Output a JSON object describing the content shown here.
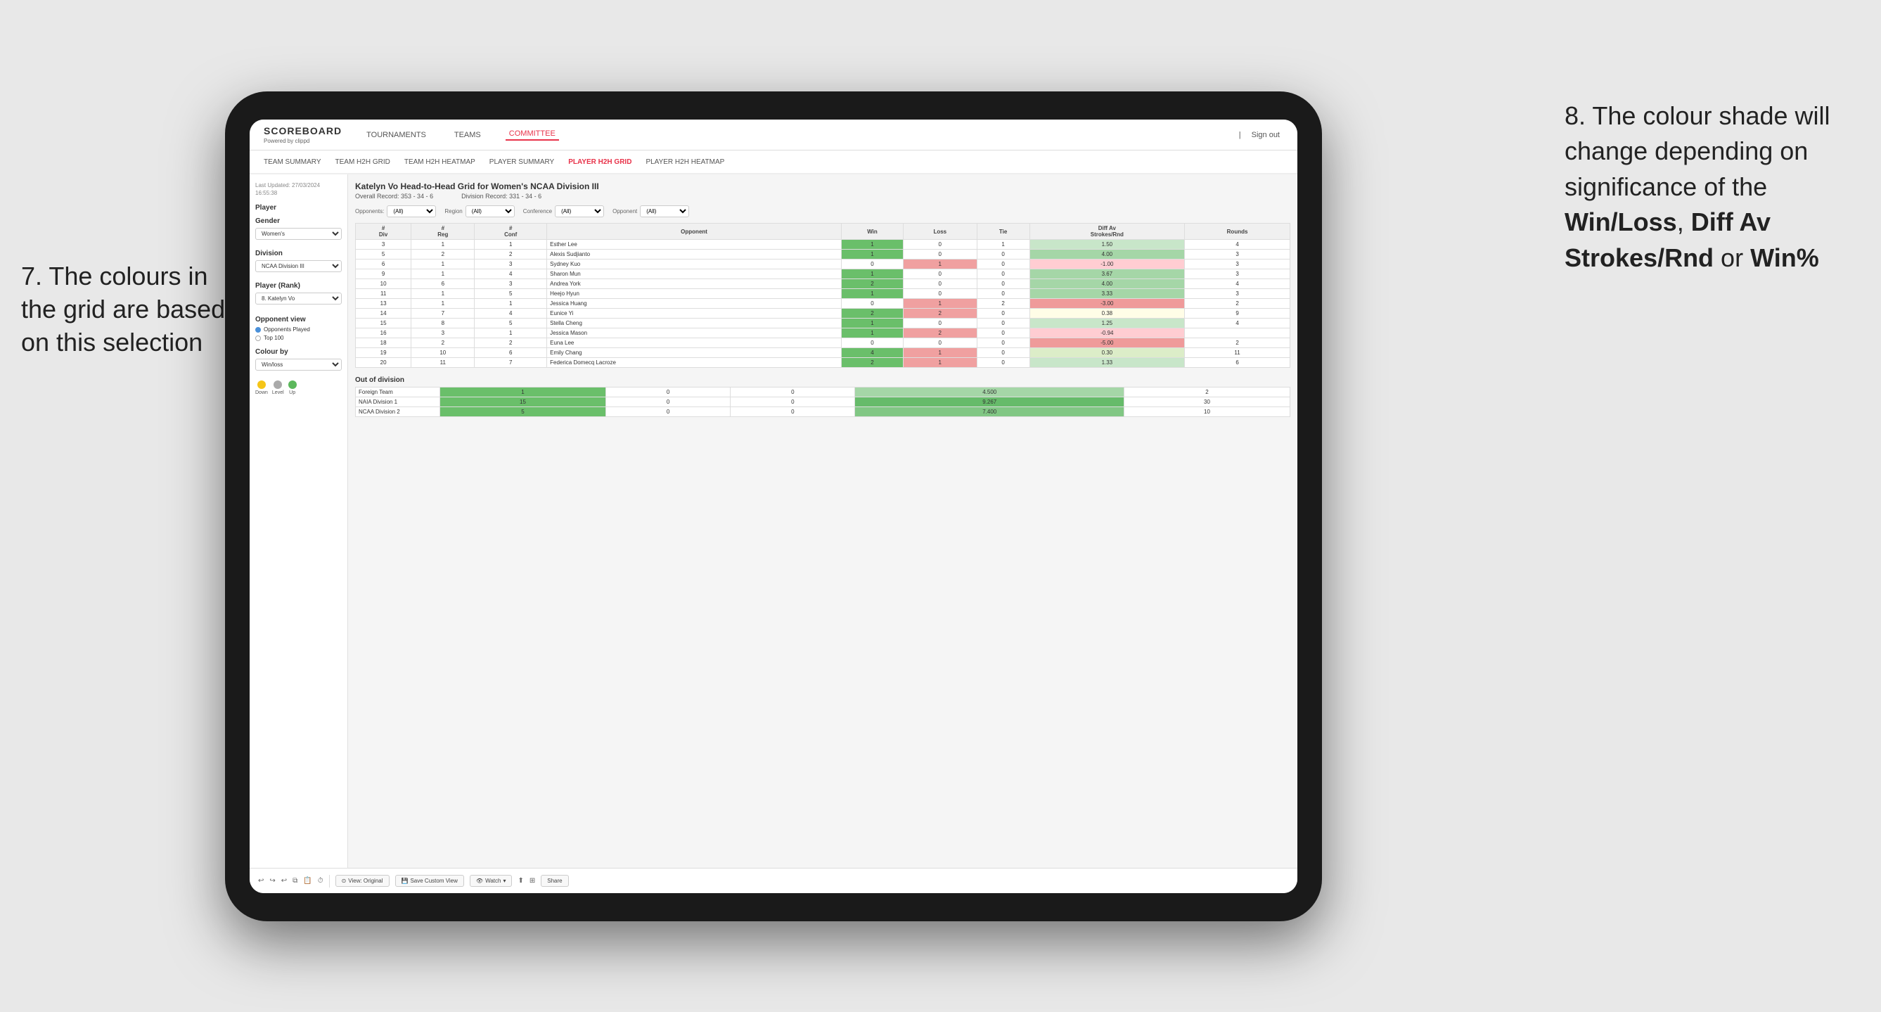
{
  "annotations": {
    "left_text_line1": "7. The colours in",
    "left_text_line2": "the grid are based",
    "left_text_line3": "on this selection",
    "right_text_intro": "8. The colour shade will change depending on significance of the ",
    "right_bold1": "Win/Loss",
    "right_comma": ", ",
    "right_bold2": "Diff Av Strokes/Rnd",
    "right_or": " or ",
    "right_bold3": "Win%"
  },
  "nav": {
    "logo": "SCOREBOARD",
    "logo_sub": "Powered by clippd",
    "items": [
      "TOURNAMENTS",
      "TEAMS",
      "COMMITTEE"
    ],
    "active": "COMMITTEE",
    "sign_in": "Sign out"
  },
  "sub_nav": {
    "items": [
      "TEAM SUMMARY",
      "TEAM H2H GRID",
      "TEAM H2H HEATMAP",
      "PLAYER SUMMARY",
      "PLAYER H2H GRID",
      "PLAYER H2H HEATMAP"
    ],
    "active": "PLAYER H2H GRID"
  },
  "left_panel": {
    "last_updated_label": "Last Updated: 27/03/2024",
    "last_updated_time": "16:55:38",
    "player_label": "Player",
    "gender_label": "Gender",
    "gender_value": "Women's",
    "division_label": "Division",
    "division_value": "NCAA Division III",
    "player_rank_label": "Player (Rank)",
    "player_rank_value": "8. Katelyn Vo",
    "opponent_view_label": "Opponent view",
    "opponents_played": "Opponents Played",
    "top_100": "Top 100",
    "colour_by_label": "Colour by",
    "colour_by_value": "Win/loss",
    "legend": {
      "down_label": "Down",
      "level_label": "Level",
      "up_label": "Up"
    }
  },
  "grid": {
    "title": "Katelyn Vo Head-to-Head Grid for Women's NCAA Division III",
    "overall_record_label": "Overall Record:",
    "overall_record": "353 - 34 - 6",
    "division_record_label": "Division Record:",
    "division_record": "331 - 34 - 6",
    "filters": {
      "opponents_label": "Opponents:",
      "opponents_value": "(All)",
      "region_label": "Region",
      "region_value": "(All)",
      "conference_label": "Conference",
      "conference_value": "(All)",
      "opponent_label": "Opponent",
      "opponent_value": "(All)"
    },
    "headers": {
      "div": "#\nDiv",
      "reg": "#\nReg",
      "conf": "#\nConf",
      "opponent": "Opponent",
      "win": "Win",
      "loss": "Loss",
      "tie": "Tie",
      "diff_av": "Diff Av\nStrokes/Rnd",
      "rounds": "Rounds"
    },
    "rows": [
      {
        "div": 3,
        "reg": 1,
        "conf": 1,
        "opponent": "Esther Lee",
        "win": 1,
        "loss": 0,
        "tie": 1,
        "diff": "1.50",
        "rounds": 4,
        "color": "light-green"
      },
      {
        "div": 5,
        "reg": 2,
        "conf": 2,
        "opponent": "Alexis Sudjianto",
        "win": 1,
        "loss": 0,
        "tie": 0,
        "diff": "4.00",
        "rounds": 3,
        "color": "green"
      },
      {
        "div": 6,
        "reg": 1,
        "conf": 3,
        "opponent": "Sydney Kuo",
        "win": 0,
        "loss": 1,
        "tie": 0,
        "diff": "-1.00",
        "rounds": 3,
        "color": "red"
      },
      {
        "div": 9,
        "reg": 1,
        "conf": 4,
        "opponent": "Sharon Mun",
        "win": 1,
        "loss": 0,
        "tie": 0,
        "diff": "3.67",
        "rounds": 3,
        "color": "green"
      },
      {
        "div": 10,
        "reg": 6,
        "conf": 3,
        "opponent": "Andrea York",
        "win": 2,
        "loss": 0,
        "tie": 0,
        "diff": "4.00",
        "rounds": 4,
        "color": "green"
      },
      {
        "div": 11,
        "reg": 1,
        "conf": 5,
        "opponent": "Heejo Hyun",
        "win": 1,
        "loss": 0,
        "tie": 0,
        "diff": "3.33",
        "rounds": 3,
        "color": "green"
      },
      {
        "div": 13,
        "reg": 1,
        "conf": 1,
        "opponent": "Jessica Huang",
        "win": 0,
        "loss": 1,
        "tie": 2,
        "diff": "-3.00",
        "rounds": 2,
        "color": "orange"
      },
      {
        "div": 14,
        "reg": 7,
        "conf": 4,
        "opponent": "Eunice Yi",
        "win": 2,
        "loss": 2,
        "tie": 0,
        "diff": "0.38",
        "rounds": 9,
        "color": "pale-yellow"
      },
      {
        "div": 15,
        "reg": 8,
        "conf": 5,
        "opponent": "Stella Cheng",
        "win": 1,
        "loss": 0,
        "tie": 0,
        "diff": "1.25",
        "rounds": 4,
        "color": "light-green"
      },
      {
        "div": 16,
        "reg": 3,
        "conf": 1,
        "opponent": "Jessica Mason",
        "win": 1,
        "loss": 2,
        "tie": 0,
        "diff": "-0.94",
        "rounds": "",
        "color": "pale-red"
      },
      {
        "div": 18,
        "reg": 2,
        "conf": 2,
        "opponent": "Euna Lee",
        "win": 0,
        "loss": 0,
        "tie": 0,
        "diff": "-5.00",
        "rounds": 2,
        "color": "red"
      },
      {
        "div": 19,
        "reg": 10,
        "conf": 6,
        "opponent": "Emily Chang",
        "win": 4,
        "loss": 1,
        "tie": 0,
        "diff": "0.30",
        "rounds": 11,
        "color": "pale-green"
      },
      {
        "div": 20,
        "reg": 11,
        "conf": 7,
        "opponent": "Federica Domecq Lacroze",
        "win": 2,
        "loss": 1,
        "tie": 0,
        "diff": "1.33",
        "rounds": 6,
        "color": "light-green"
      }
    ],
    "out_division_label": "Out of division",
    "out_division_rows": [
      {
        "opponent": "Foreign Team",
        "win": 1,
        "loss": 0,
        "tie": 0,
        "diff": "4.500",
        "rounds": 2,
        "color": "green"
      },
      {
        "opponent": "NAIA Division 1",
        "win": 15,
        "loss": 0,
        "tie": 0,
        "diff": "9.267",
        "rounds": 30,
        "color": "dark-green"
      },
      {
        "opponent": "NCAA Division 2",
        "win": 5,
        "loss": 0,
        "tie": 0,
        "diff": "7.400",
        "rounds": 10,
        "color": "green"
      }
    ]
  },
  "toolbar": {
    "view_original": "View: Original",
    "save_custom": "Save Custom View",
    "watch": "Watch",
    "share": "Share"
  }
}
